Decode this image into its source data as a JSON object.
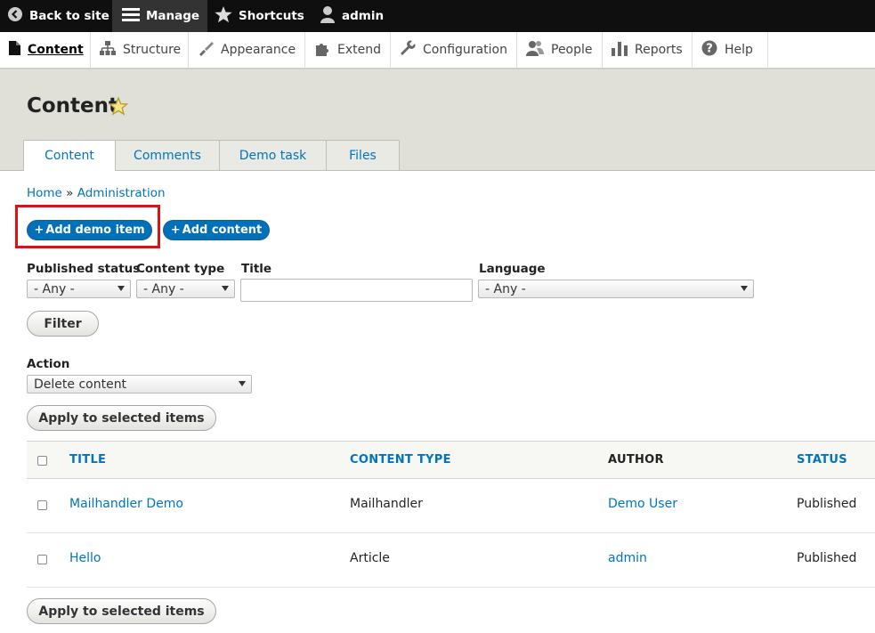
{
  "toolbar": {
    "back": "Back to site",
    "manage": "Manage",
    "shortcuts": "Shortcuts",
    "user": "admin"
  },
  "tray": {
    "content": "Content",
    "structure": "Structure",
    "appearance": "Appearance",
    "extend": "Extend",
    "configuration": "Configuration",
    "people": "People",
    "reports": "Reports",
    "help": "Help"
  },
  "page": {
    "title": "Content"
  },
  "tabs": [
    "Content",
    "Comments",
    "Demo task",
    "Files"
  ],
  "breadcrumb": {
    "home": "Home",
    "sep": "»",
    "admin": "Administration"
  },
  "actions": {
    "add_demo": "Add demo item",
    "add_content": "Add content"
  },
  "filters": {
    "published_label": "Published status",
    "published_value": "- Any -",
    "type_label": "Content type",
    "type_value": "- Any -",
    "title_label": "Title",
    "language_label": "Language",
    "language_value": "- Any -",
    "filter_button": "Filter"
  },
  "bulk": {
    "action_label": "Action",
    "action_value": "Delete content",
    "apply": "Apply to selected items"
  },
  "table": {
    "headers": {
      "title": "TITLE",
      "type": "CONTENT TYPE",
      "author": "AUTHOR",
      "status": "STATUS"
    },
    "rows": [
      {
        "title": "Mailhandler Demo",
        "type": "Mailhandler",
        "author": "Demo User",
        "status": "Published"
      },
      {
        "title": "Hello",
        "type": "Article",
        "author": "admin",
        "status": "Published"
      }
    ]
  },
  "colors": {
    "link": "#0074bd",
    "primary_button": "#0071b8",
    "highlight_box": "#e01111",
    "header_bg": "#e0e0d8"
  }
}
